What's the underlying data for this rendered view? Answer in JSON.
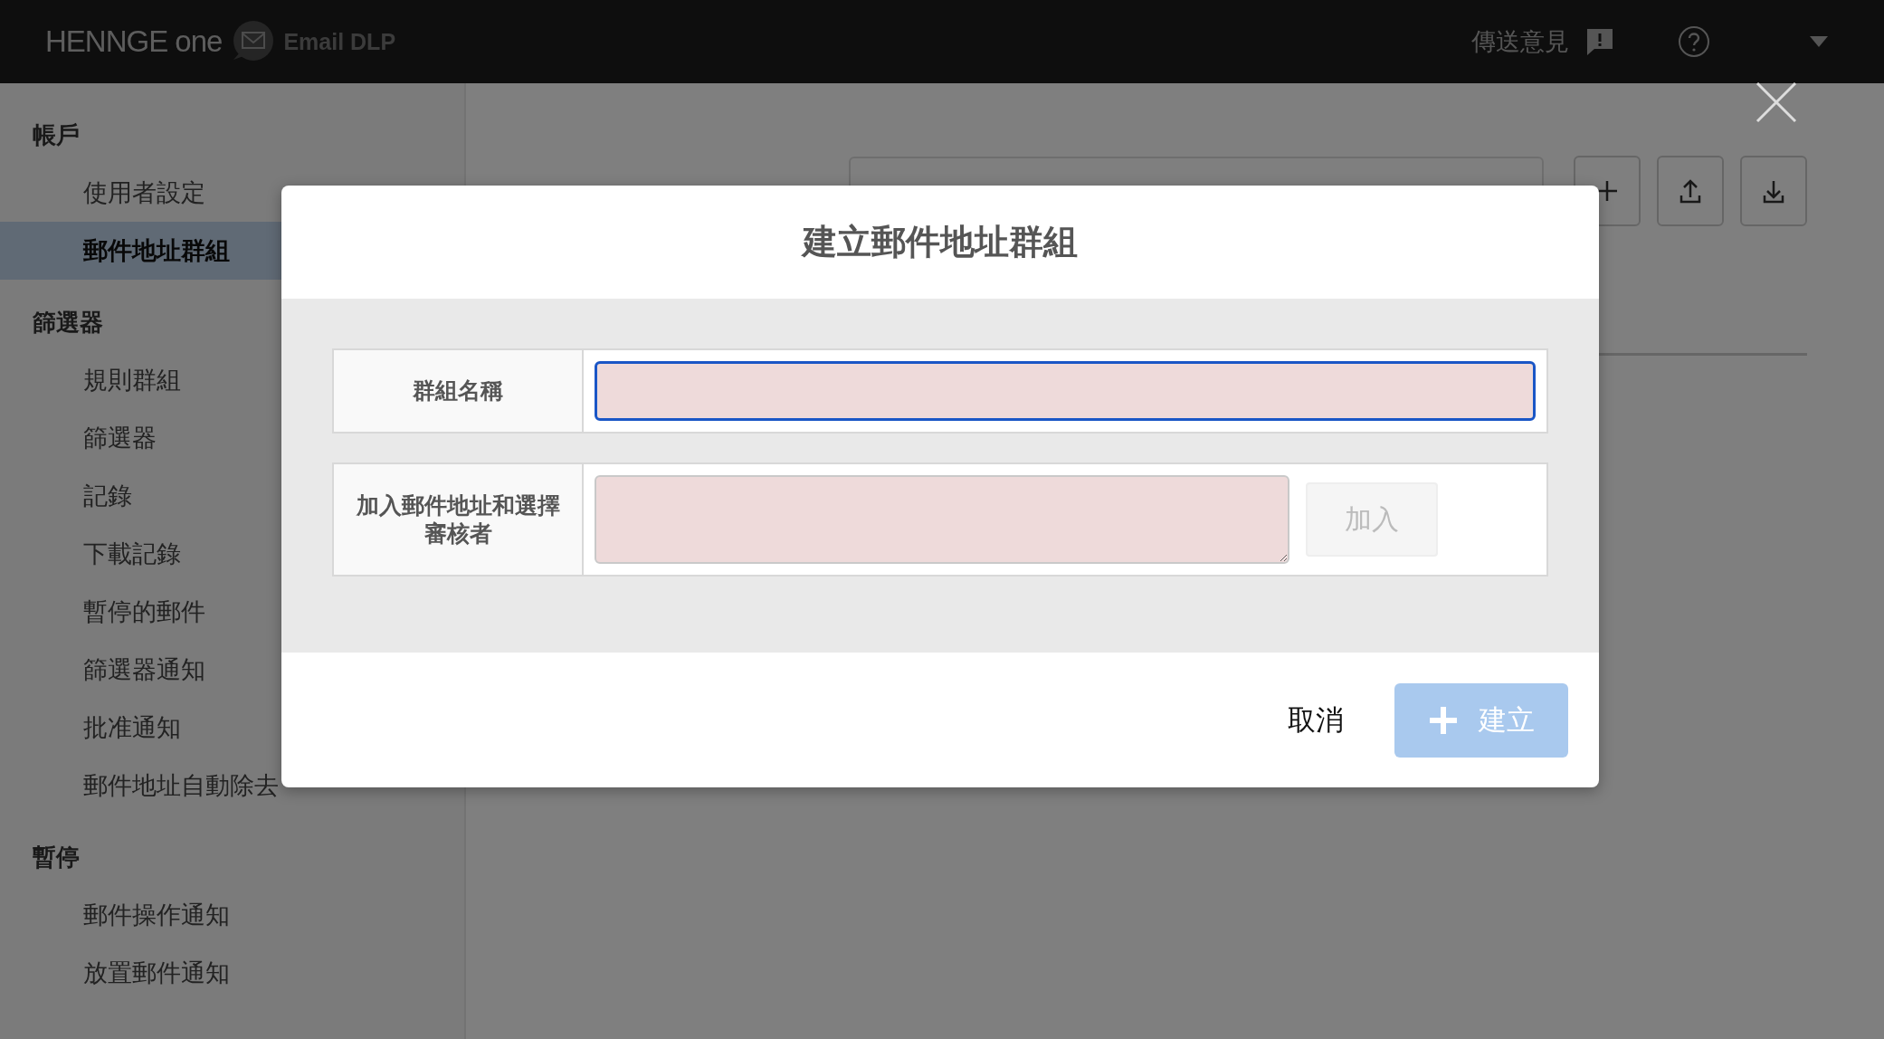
{
  "header": {
    "brand": "HENNGE one",
    "product": "Email DLP",
    "feedback": "傳送意見"
  },
  "sidebar": {
    "sections": [
      {
        "title": "帳戶",
        "items": [
          {
            "label": "使用者設定",
            "selected": false
          },
          {
            "label": "郵件地址群組",
            "selected": true
          }
        ]
      },
      {
        "title": "篩選器",
        "items": [
          {
            "label": "規則群組",
            "selected": false
          },
          {
            "label": "篩選器",
            "selected": false
          },
          {
            "label": "記錄",
            "selected": false
          },
          {
            "label": "下載記錄",
            "selected": false
          },
          {
            "label": "暫停的郵件",
            "selected": false
          },
          {
            "label": "篩選器通知",
            "selected": false
          },
          {
            "label": "批准通知",
            "selected": false
          },
          {
            "label": "郵件地址自動除去",
            "selected": false
          }
        ]
      },
      {
        "title": "暫停",
        "items": [
          {
            "label": "郵件操作通知",
            "selected": false
          },
          {
            "label": "放置郵件通知",
            "selected": false
          }
        ]
      }
    ]
  },
  "dialog": {
    "title": "建立郵件地址群組",
    "fields": [
      {
        "kind": "input",
        "label": "群組名稱",
        "focused": true
      },
      {
        "kind": "textarea",
        "label": "加入郵件地址和選擇審核者",
        "focused": false,
        "button": {
          "label": "加入",
          "disabled": true
        }
      }
    ],
    "cancel": "取消",
    "submit": {
      "label": "建立",
      "disabled": true
    }
  }
}
